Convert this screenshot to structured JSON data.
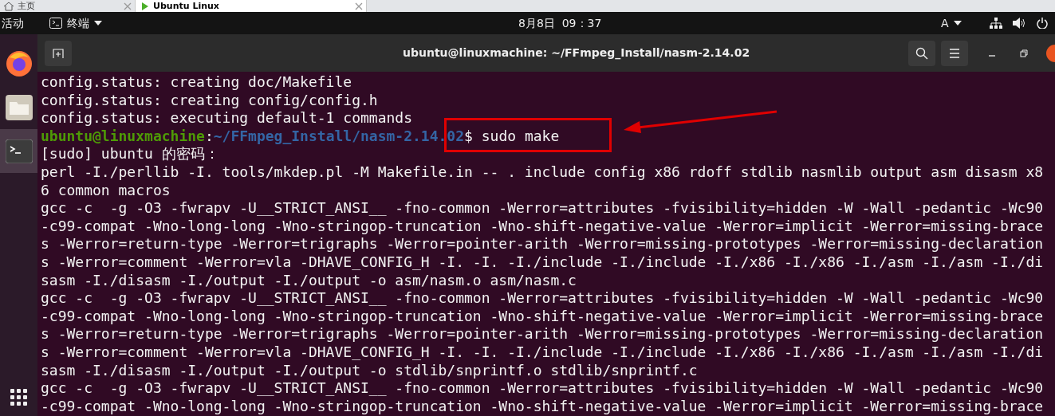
{
  "vm_tabs": [
    {
      "label": "主页",
      "selected": false
    },
    {
      "label": "Ubuntu Linux",
      "selected": true
    }
  ],
  "top_bar": {
    "activities": "活动",
    "app_menu": "终端",
    "clock": "8月8日  09：37",
    "input_method": "A"
  },
  "dock": [
    {
      "kind": "browser",
      "selected": false
    },
    {
      "kind": "files",
      "selected": false
    },
    {
      "kind": "terminal",
      "selected": true
    }
  ],
  "terminal": {
    "title": "ubuntu@linuxmachine: ~/FFmpeg_Install/nasm-2.14.02",
    "lines": [
      {
        "kind": "output",
        "text": "config.status: creating doc/Makefile"
      },
      {
        "kind": "output",
        "text": "config.status: creating config/config.h"
      },
      {
        "kind": "output",
        "text": "config.status: executing default-1 commands"
      },
      {
        "kind": "prompt",
        "user": "ubuntu@linuxmachine",
        "separator": ":",
        "path": "~/FFmpeg_Install/nasm-2.14.02",
        "command": "$ sudo make",
        "highlighted": true
      },
      {
        "kind": "output",
        "text": "[sudo] ubuntu 的密码："
      },
      {
        "kind": "output",
        "text": "perl -I./perllib -I. tools/mkdep.pl -M Makefile.in -- . include config x86 rdoff stdlib nasmlib output asm disasm x8"
      },
      {
        "kind": "output",
        "text": "6 common macros"
      },
      {
        "kind": "output",
        "text": "gcc -c  -g -O3 -fwrapv -U__STRICT_ANSI__ -fno-common -Werror=attributes -fvisibility=hidden -W -Wall -pedantic -Wc90"
      },
      {
        "kind": "output",
        "text": "-c99-compat -Wno-long-long -Wno-stringop-truncation -Wno-shift-negative-value -Werror=implicit -Werror=missing-brace"
      },
      {
        "kind": "output",
        "text": "s -Werror=return-type -Werror=trigraphs -Werror=pointer-arith -Werror=missing-prototypes -Werror=missing-declaration"
      },
      {
        "kind": "output",
        "text": "s -Werror=comment -Werror=vla -DHAVE_CONFIG_H -I. -I. -I./include -I./include -I./x86 -I./x86 -I./asm -I./asm -I./di"
      },
      {
        "kind": "output",
        "text": "sasm -I./disasm -I./output -I./output -o asm/nasm.o asm/nasm.c"
      },
      {
        "kind": "output",
        "text": "gcc -c  -g -O3 -fwrapv -U__STRICT_ANSI__ -fno-common -Werror=attributes -fvisibility=hidden -W -Wall -pedantic -Wc90"
      },
      {
        "kind": "output",
        "text": "-c99-compat -Wno-long-long -Wno-stringop-truncation -Wno-shift-negative-value -Werror=implicit -Werror=missing-brace"
      },
      {
        "kind": "output",
        "text": "s -Werror=return-type -Werror=trigraphs -Werror=pointer-arith -Werror=missing-prototypes -Werror=missing-declaration"
      },
      {
        "kind": "output",
        "text": "s -Werror=comment -Werror=vla -DHAVE_CONFIG_H -I. -I. -I./include -I./include -I./x86 -I./x86 -I./asm -I./asm -I./di"
      },
      {
        "kind": "output",
        "text": "sasm -I./disasm -I./output -I./output -o stdlib/snprintf.o stdlib/snprintf.c"
      },
      {
        "kind": "output",
        "text": "gcc -c  -g -O3 -fwrapv -U__STRICT_ANSI__ -fno-common -Werror=attributes -fvisibility=hidden -W -Wall -pedantic -Wc90"
      },
      {
        "kind": "output",
        "text": "-c99-compat -Wno-long-long -Wno-stringop-truncation -Wno-shift-negative-value -Werror=implicit -Werror=missing-brace"
      }
    ]
  }
}
